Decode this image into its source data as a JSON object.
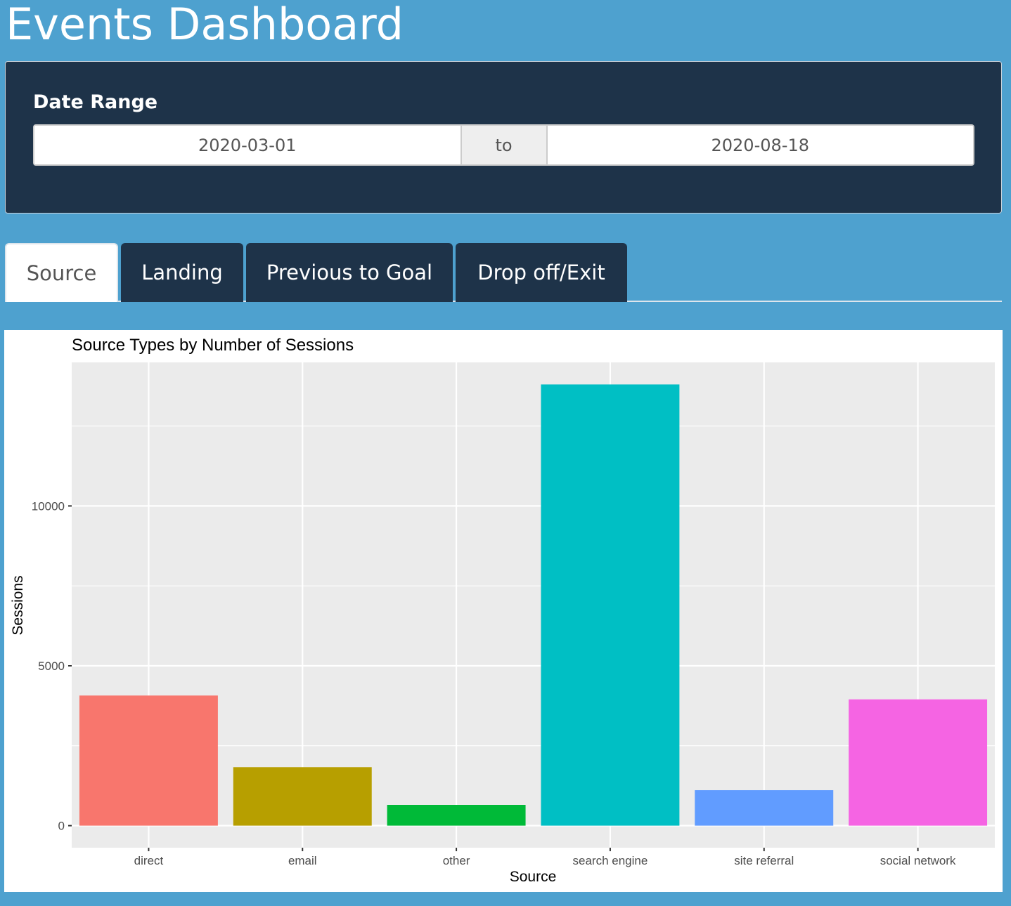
{
  "header": {
    "title": "Events Dashboard"
  },
  "date_range": {
    "label": "Date Range",
    "start": "2020-03-01",
    "separator": "to",
    "end": "2020-08-18"
  },
  "tabs": [
    {
      "label": "Source",
      "active": true
    },
    {
      "label": "Landing",
      "active": false
    },
    {
      "label": "Previous to Goal",
      "active": false
    },
    {
      "label": "Drop off/Exit",
      "active": false
    }
  ],
  "chart_data": {
    "type": "bar",
    "title": "Source Types by Number of Sessions",
    "xlabel": "Source",
    "ylabel": "Sessions",
    "categories": [
      "direct",
      "email",
      "other",
      "search engine",
      "site referral",
      "social network"
    ],
    "values": [
      4070,
      1830,
      650,
      13800,
      1110,
      3950
    ],
    "colors": [
      "#f8766d",
      "#b79f00",
      "#00ba38",
      "#00bfc4",
      "#619cff",
      "#f564e3"
    ],
    "yticks": [
      0,
      5000,
      10000
    ],
    "ylim": [
      -690,
      14490
    ],
    "grid": true,
    "panel_background": "#ebebeb"
  }
}
